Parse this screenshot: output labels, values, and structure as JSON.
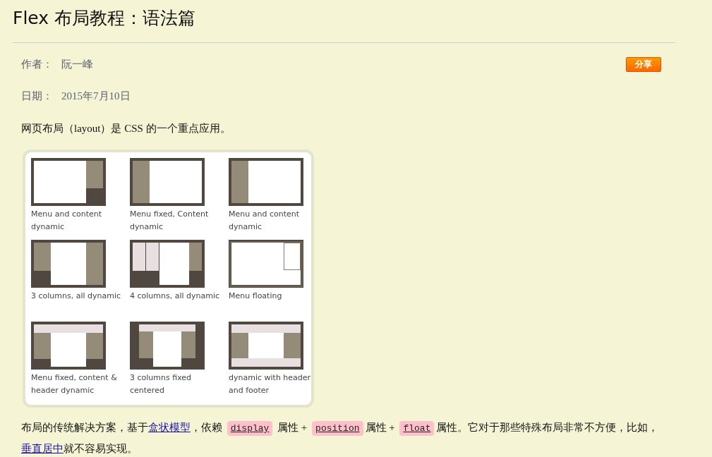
{
  "title": "Flex 布局教程：语法篇",
  "meta": [
    {
      "label": "作者：",
      "value": "阮一峰"
    },
    {
      "label": "日期：",
      "value": "2015年7月10日"
    }
  ],
  "share_button": "分享",
  "intro": "网页布局（layout）是 CSS 的一个重点应用。",
  "layouts": [
    {
      "kind": "right-menu",
      "caption": "Menu and content dynamic"
    },
    {
      "kind": "left-menu",
      "caption": "Menu fixed, Content dynamic"
    },
    {
      "kind": "left-menu",
      "caption": "Menu and content dynamic"
    },
    {
      "kind": "three-col",
      "caption": "3 columns, all dynamic"
    },
    {
      "kind": "four-col",
      "caption": "4 columns, all dynamic"
    },
    {
      "kind": "float",
      "caption": "Menu floating"
    },
    {
      "kind": "header-three",
      "caption": "Menu fixed, content & header dynamic"
    },
    {
      "kind": "centered",
      "caption": "3 columns fixed centered"
    },
    {
      "kind": "header-footer",
      "caption": "dynamic with header and footer"
    }
  ],
  "paragraph": [
    {
      "kind": "text",
      "text": "布局的传统解决方案，基于"
    },
    {
      "kind": "link",
      "text": "盒状模型"
    },
    {
      "kind": "text",
      "text": "，依赖 "
    },
    {
      "kind": "code",
      "text": "display"
    },
    {
      "kind": "text",
      "text": " 属性 + "
    },
    {
      "kind": "code",
      "text": "position"
    },
    {
      "kind": "text",
      "text": "属性 + "
    },
    {
      "kind": "code",
      "text": "float"
    },
    {
      "kind": "text",
      "text": "属性。它对于那些特殊布局非常不方便，比如，"
    },
    {
      "kind": "link",
      "text": "垂直居中"
    },
    {
      "kind": "text",
      "text": "就不容易实现。"
    }
  ]
}
